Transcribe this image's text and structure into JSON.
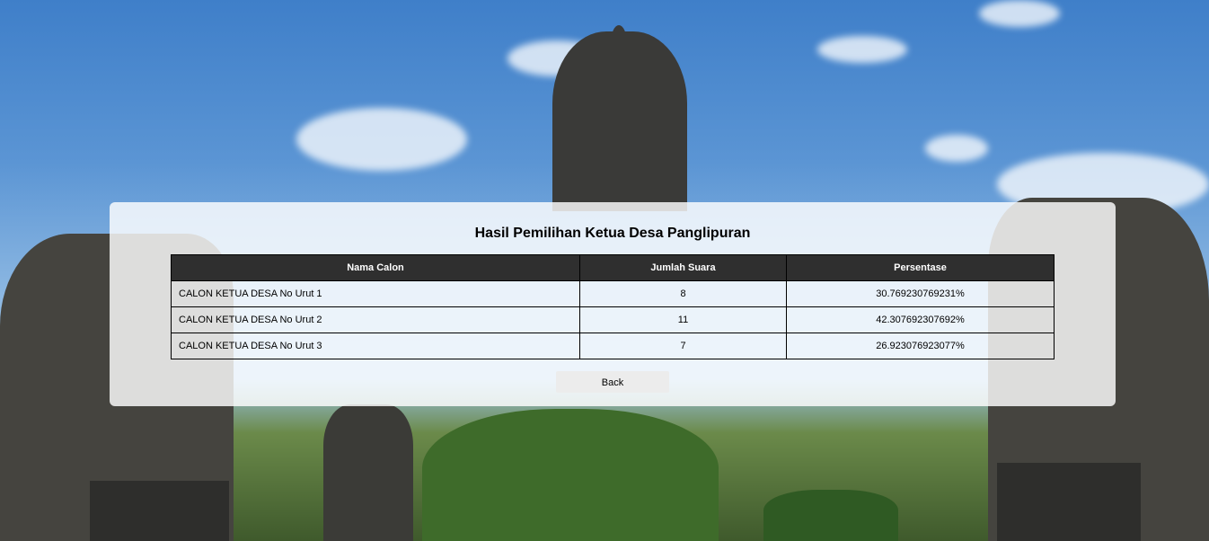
{
  "page": {
    "title": "Hasil Pemilihan Ketua Desa Panglipuran"
  },
  "table": {
    "headers": [
      "Nama Calon",
      "Jumlah Suara",
      "Persentase"
    ],
    "rows": [
      {
        "nama": "CALON KETUA DESA No Urut 1",
        "suara": "8",
        "persen": "30.769230769231%"
      },
      {
        "nama": "CALON KETUA DESA No Urut 2",
        "suara": "11",
        "persen": "42.307692307692%"
      },
      {
        "nama": "CALON KETUA DESA No Urut 3",
        "suara": "7",
        "persen": "26.923076923077%"
      }
    ]
  },
  "actions": {
    "back_label": "Back"
  },
  "colors": {
    "header_bg": "#2f2f2f",
    "panel_bg": "rgba(255,255,255,0.82)",
    "sky": "#5b95d4"
  }
}
